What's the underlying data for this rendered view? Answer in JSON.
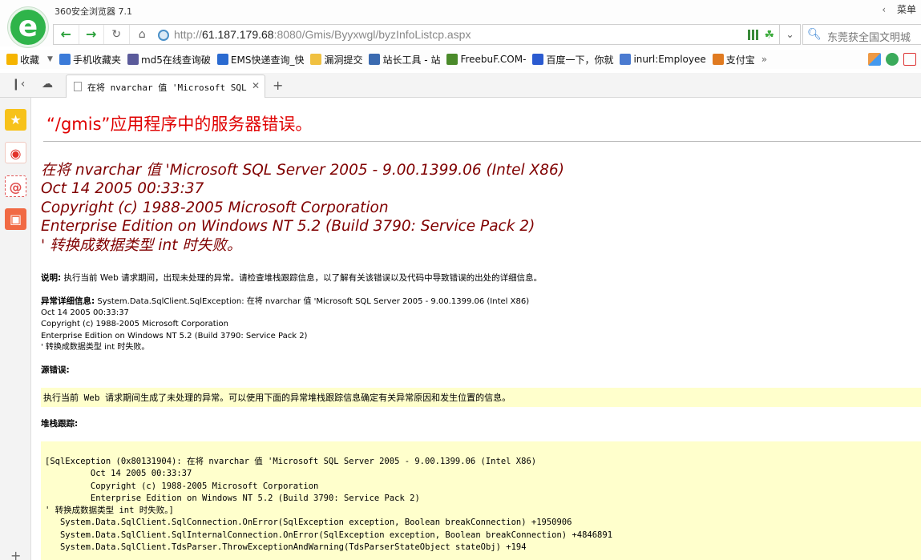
{
  "browser": {
    "app_title": "360安全浏览器 7.1",
    "menu_label": "菜单",
    "url_host": "61.187.179.68",
    "url_rest": ":8080/Gmis/Byyxwgl/byzInfoListcp.aspx",
    "url_scheme": "http://",
    "search_text": "东莞获全国文明城",
    "accent_color": "#2fb44a"
  },
  "bookmarks": [
    {
      "label": "收藏",
      "color": "#f5b400"
    },
    {
      "label": "手机收藏夹",
      "color": "#3a7ad8"
    },
    {
      "label": "md5在线查询破",
      "color": "#5a5a9a"
    },
    {
      "label": "EMS快递查询_快",
      "color": "#2a6ad0"
    },
    {
      "label": "漏洞提交",
      "color": "#f0c040"
    },
    {
      "label": "站长工具 - 站",
      "color": "#3a6ab0"
    },
    {
      "label": "FreebuF.COM-",
      "color": "#4a8a2a"
    },
    {
      "label": "百度一下，你就",
      "color": "#2a5ad0"
    },
    {
      "label": "inurl:Employee",
      "color": "#4a7ad0"
    },
    {
      "label": "支付宝",
      "color": "#e07a20"
    }
  ],
  "tab": {
    "title": "在将 nvarchar 值 'Microsoft SQL Se",
    "new_tab_label": "+"
  },
  "page": {
    "heading": "“/gmis”应用程序中的服务器错误。",
    "error_title": "在将 nvarchar 值 'Microsoft SQL Server 2005 - 9.00.1399.06 (Intel X86)\nOct 14 2005 00:33:37\nCopyright (c) 1988-2005 Microsoft Corporation\nEnterprise Edition on Windows NT 5.2 (Build 3790: Service Pack 2)\n' 转换成数据类型 int 时失败。",
    "desc_label": "说明:",
    "desc_text": " 执行当前 Web 请求期间，出现未处理的异常。请检查堆栈跟踪信息，以了解有关该错误以及代码中导致错误的出处的详细信息。",
    "exception_label": "异常详细信息:",
    "exception_text": " System.Data.SqlClient.SqlException: 在将 nvarchar 值 'Microsoft SQL Server 2005 - 9.00.1399.06 (Intel X86)\nOct 14 2005 00:33:37\nCopyright (c) 1988-2005 Microsoft Corporation\nEnterprise Edition on Windows NT 5.2 (Build 3790: Service Pack 2)\n' 转换成数据类型 int 时失败。",
    "source_label": "源错误:",
    "source_text": "执行当前 Web 请求期间生成了未处理的异常。可以使用下面的异常堆栈跟踪信息确定有关异常原因和发生位置的信息。",
    "stack_label": "堆栈跟踪:",
    "stack_text": "[SqlException (0x80131904): 在将 nvarchar 值 'Microsoft SQL Server 2005 - 9.00.1399.06 (Intel X86)\n         Oct 14 2005 00:33:37\n         Copyright (c) 1988-2005 Microsoft Corporation\n         Enterprise Edition on Windows NT 5.2 (Build 3790: Service Pack 2)\n' 转换成数据类型 int 时失败。]\n   System.Data.SqlClient.SqlConnection.OnError(SqlException exception, Boolean breakConnection) +1950906\n   System.Data.SqlClient.SqlInternalConnection.OnError(SqlException exception, Boolean breakConnection) +4846891\n   System.Data.SqlClient.TdsParser.ThrowExceptionAndWarning(TdsParserStateObject stateObj) +194"
  }
}
